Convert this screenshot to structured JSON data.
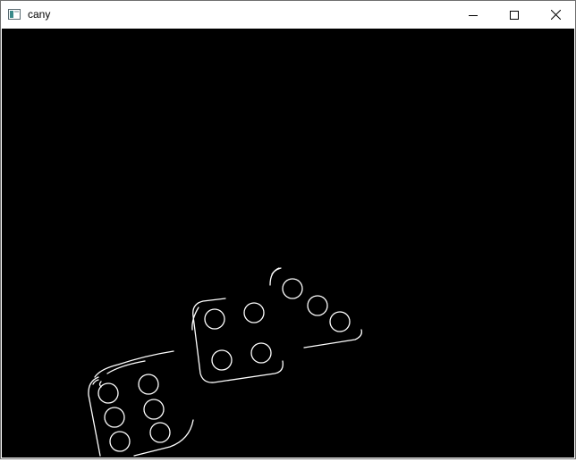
{
  "window": {
    "title": "cany",
    "controls": [
      {
        "name": "minimize",
        "icon": "minimize-icon"
      },
      {
        "name": "maximize",
        "icon": "maximize-icon"
      },
      {
        "name": "close",
        "icon": "close-icon"
      }
    ]
  },
  "image": {
    "description_icon": "canny-edge-dice",
    "background": "#000000",
    "edge_color": "#ffffff"
  }
}
